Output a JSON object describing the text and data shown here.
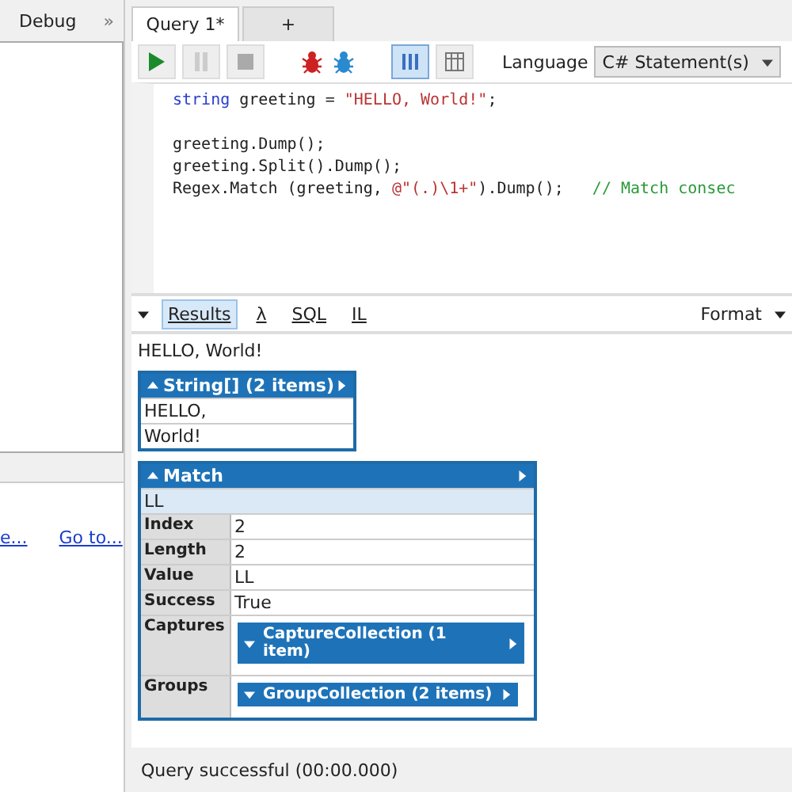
{
  "left_panel": {
    "tab": "Debug",
    "collapse": "»",
    "links": [
      "e...",
      "Go to..."
    ]
  },
  "query_tabs": [
    {
      "label": "Query 1*",
      "selected": true
    },
    {
      "label": "+",
      "selected": false
    }
  ],
  "toolbar": {
    "run": {
      "disabled": false
    },
    "pause": {
      "disabled": true
    },
    "stop": {
      "disabled": true
    },
    "layouts": [
      {
        "kind": "rows",
        "selected": true
      },
      {
        "kind": "columns",
        "selected": false
      }
    ],
    "language_label": "Language",
    "language": "C# Statement(s)"
  },
  "code_blocks": [
    [
      [
        {
          "kind": "keyword",
          "text": "string"
        },
        {
          "kind": "plain",
          "text": " greeting = "
        },
        {
          "kind": "string",
          "text": "\"HELLO, World!\""
        },
        {
          "kind": "plain",
          "text": ";"
        }
      ]
    ],
    [
      [
        {
          "kind": "plain",
          "text": "greeting.Dump();"
        }
      ],
      [
        {
          "kind": "plain",
          "text": "greeting.Split().Dump();"
        }
      ],
      [
        {
          "kind": "plain",
          "text": "Regex.Match (greeting, "
        },
        {
          "kind": "string",
          "text": "@\"(.)\\1+\""
        },
        {
          "kind": "plain",
          "text": ").Dump();   "
        },
        {
          "kind": "comment",
          "text": "// Match consec"
        }
      ]
    ]
  ],
  "result_tabs": [
    {
      "label": "Results",
      "selected": true
    },
    {
      "label": "λ",
      "selected": false
    },
    {
      "label": "SQL",
      "selected": false
    },
    {
      "label": "IL",
      "selected": false
    }
  ],
  "format": "Format",
  "output": {
    "text": "HELLO, World!",
    "array": {
      "title": "String[] (2 items)",
      "items": [
        "HELLO,",
        "World!"
      ]
    },
    "match": {
      "title": "Match",
      "value": "LL",
      "rows": [
        {
          "kind": "text",
          "label": "Index",
          "value": "2"
        },
        {
          "kind": "text",
          "label": "Length",
          "value": "2"
        },
        {
          "kind": "text",
          "label": "Value",
          "value": "LL"
        },
        {
          "kind": "text",
          "label": "Success",
          "value": "True"
        },
        {
          "kind": "collection",
          "label": "Captures",
          "value": "CaptureCollection (1 item)"
        },
        {
          "kind": "collection",
          "label": "Groups",
          "value": "GroupCollection (2 items)"
        }
      ]
    }
  },
  "status": "Query successful  (00:00.000)"
}
